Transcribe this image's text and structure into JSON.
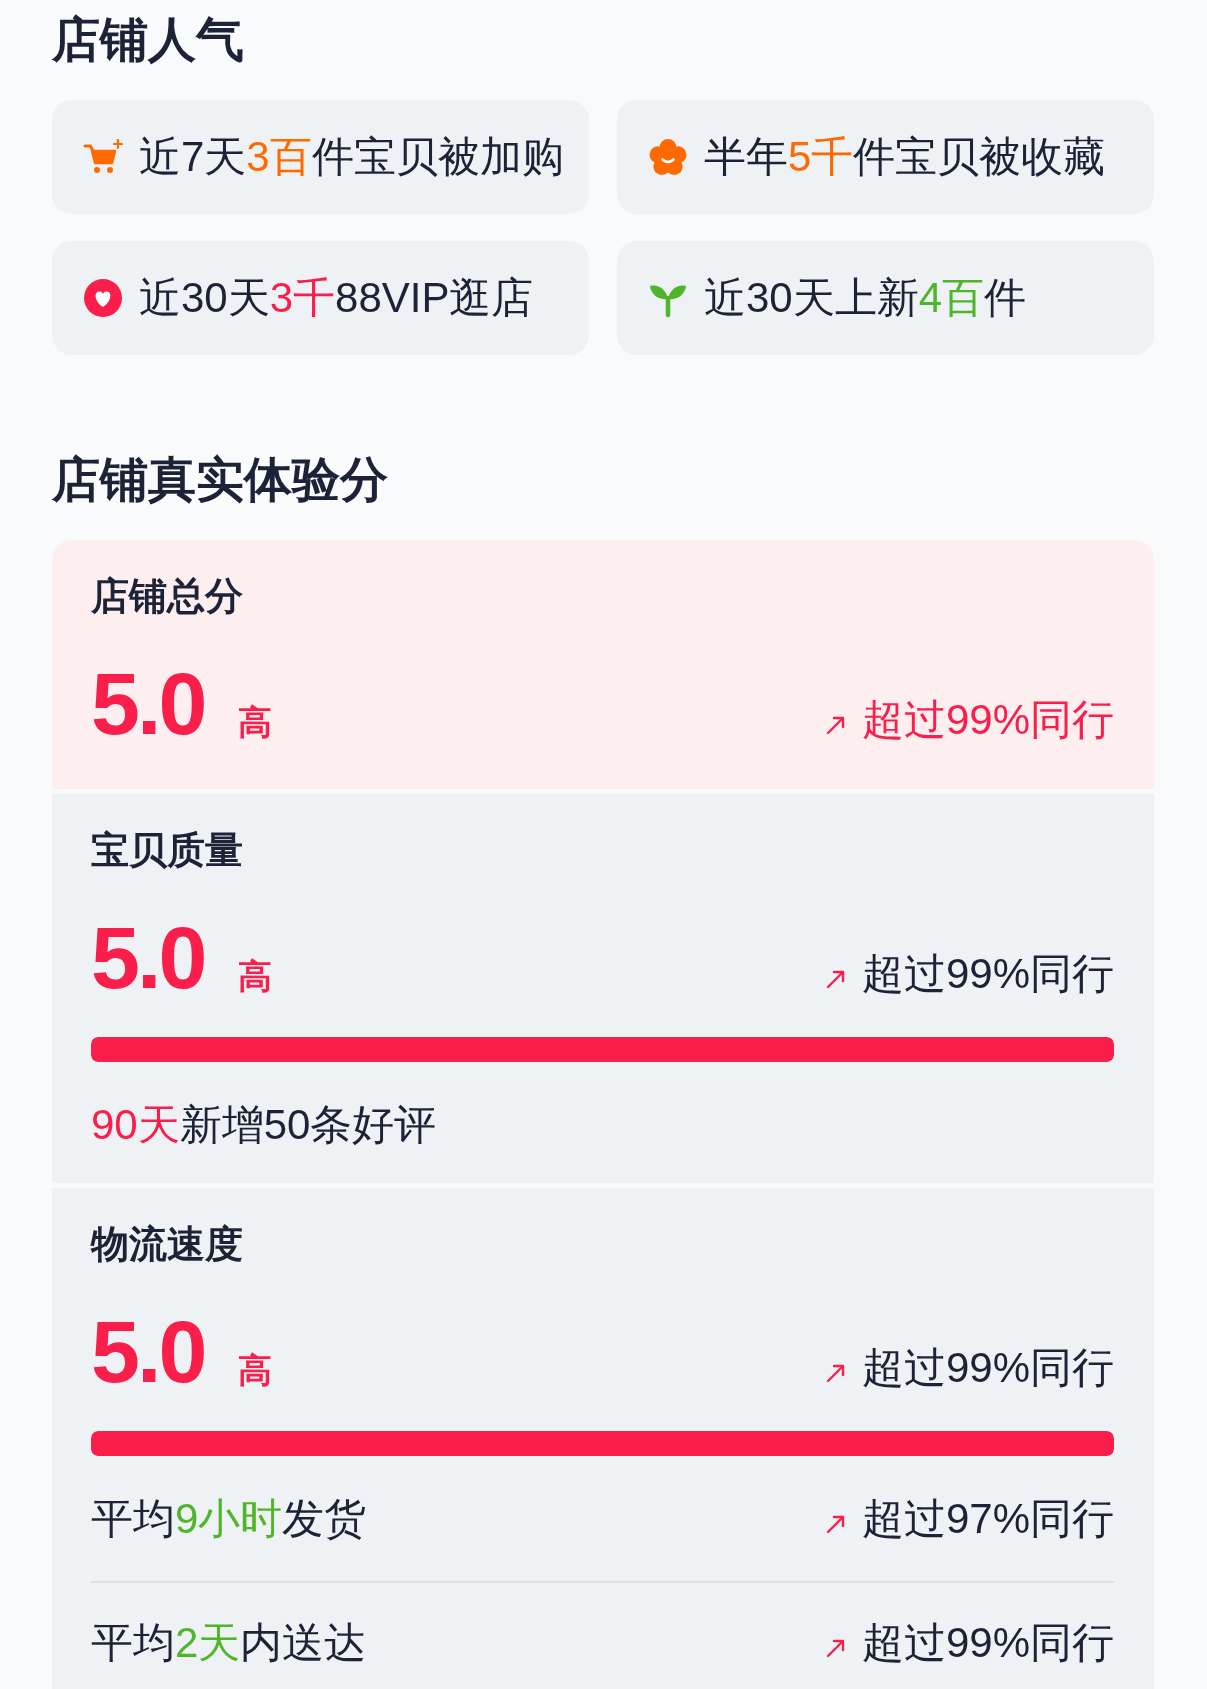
{
  "popularity": {
    "title": "店铺人气",
    "stats": [
      {
        "kind": "cart",
        "color": "#ff6a00",
        "before": "近7天",
        "highlight": "3百",
        "after": "件宝贝被加购"
      },
      {
        "kind": "flower",
        "color": "#ff6a00",
        "before": "半年",
        "highlight": "5千",
        "after": "件宝贝被收藏"
      },
      {
        "kind": "heart",
        "color": "#fa1e4b",
        "before": "近30天",
        "highlight": "3千",
        "after": "88VIP逛店"
      },
      {
        "kind": "sprout",
        "color": "#4fb52b",
        "before": "近30天上新",
        "highlight": "4百",
        "after": "件"
      }
    ]
  },
  "experience": {
    "title": "店铺真实体验分",
    "cards": [
      {
        "kind": "total",
        "label": "店铺总分",
        "score": "5.0",
        "grade": "高",
        "rank": "超过99%同行"
      },
      {
        "kind": "detail",
        "label": "宝贝质量",
        "score": "5.0",
        "grade": "高",
        "rank": "超过99%同行",
        "level": 1,
        "notes": [
          {
            "highlight": "90天",
            "after": "新增50条好评",
            "color": "#fa1e4b"
          }
        ]
      },
      {
        "kind": "detail",
        "label": "物流速度",
        "score": "5.0",
        "grade": "高",
        "rank": "超过99%同行",
        "level": 1,
        "notes": [
          {
            "before": "平均",
            "highlight": "9小时",
            "after": "发货",
            "color": "#4fb52b",
            "rank": "超过97%同行"
          },
          {
            "before": "平均",
            "highlight": "2天",
            "after": "内送达",
            "color": "#4fb52b",
            "rank": "超过99%同行"
          }
        ]
      }
    ]
  }
}
